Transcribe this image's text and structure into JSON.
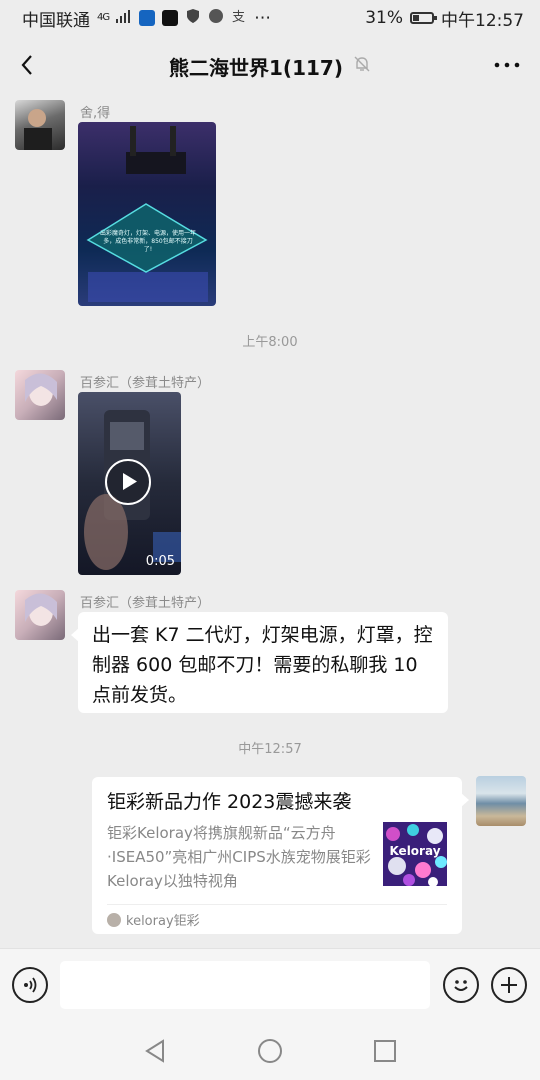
{
  "status_bar": {
    "carrier": "中国联通",
    "network": "4G",
    "battery_percent": "31%",
    "battery_level": 0.31,
    "time": "中午12:57"
  },
  "header": {
    "title": "熊二海世界1(117)",
    "muted": true
  },
  "messages": [
    {
      "sender": "舍,得",
      "type": "image",
      "image_text": "出彩魔奇灯，灯架、电源，使用一年多，成色非常新，850包邮不接刀了!"
    },
    {
      "type": "time",
      "text": "上午8:00"
    },
    {
      "sender": "百参汇（参茸土特产）",
      "type": "video",
      "duration": "0:05"
    },
    {
      "sender": "百参汇（参茸土特产）",
      "type": "text",
      "text": "出一套 K7 二代灯，灯架电源，灯罩，控制器 600 包邮不刀！需要的私聊我 10 点前发货。"
    },
    {
      "type": "time",
      "text": "中午12:57"
    },
    {
      "type": "link_card",
      "title": "钜彩新品力作 2023震撼来袭",
      "description": "钜彩Keloray将携旗舰新品“云方舟·ISEA50”亮相广州CIPS水族宠物展钜彩Keloray以独特视角",
      "thumb_text": "Keloray",
      "source": "keloray钜彩"
    }
  ],
  "input": {
    "placeholder": "",
    "value": ""
  },
  "colors": {
    "background": "#ededed",
    "bubble": "#ffffff",
    "timestamp": "#999999",
    "nickname": "#8a8a8a"
  }
}
